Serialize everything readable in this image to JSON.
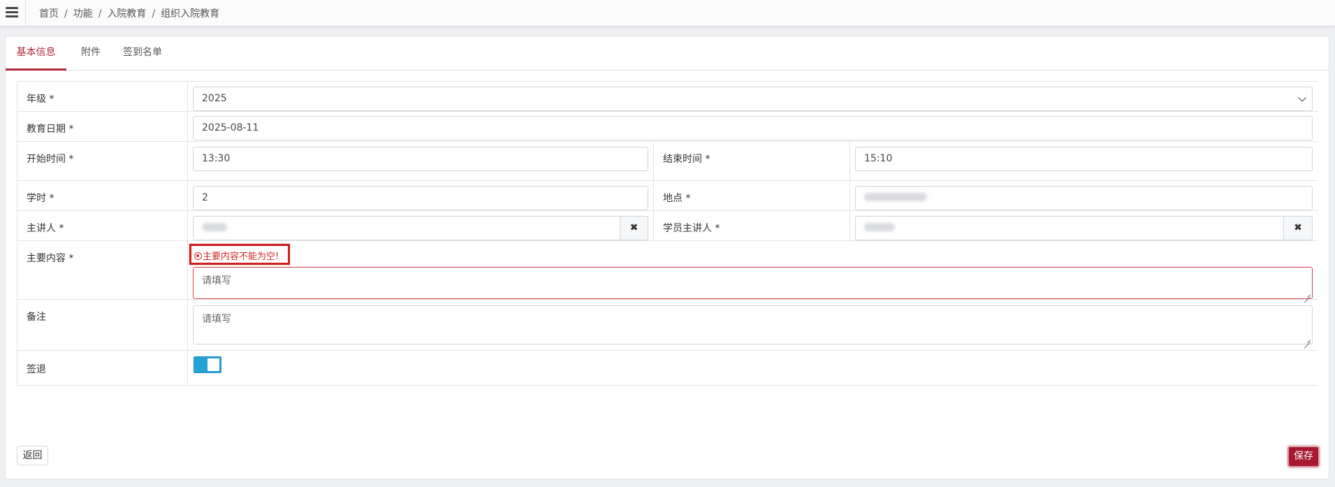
{
  "breadcrumb": {
    "items": [
      "首页",
      "功能",
      "入院教育"
    ],
    "current": "组织入院教育",
    "separator": "/"
  },
  "tabs": [
    {
      "label": "基本信息",
      "active": true
    },
    {
      "label": "附件",
      "active": false
    },
    {
      "label": "签到名单",
      "active": false
    }
  ],
  "form": {
    "grade": {
      "label": "年级 *",
      "value": "2025"
    },
    "edu_date": {
      "label": "教育日期 *",
      "value": "2025-08-11"
    },
    "start_time": {
      "label": "开始时间 *",
      "value": "13:30"
    },
    "end_time": {
      "label": "结束时间 *",
      "value": "15:10"
    },
    "hours": {
      "label": "学时 *",
      "value": "2"
    },
    "location": {
      "label": "地点 *"
    },
    "speaker": {
      "label": "主讲人 *",
      "clear_icon": "✖"
    },
    "student_speaker": {
      "label": "学员主讲人 *",
      "clear_icon": "✖"
    },
    "main_content": {
      "label": "主要内容 *",
      "error": "主要内容不能为空!",
      "placeholder": "请填写"
    },
    "remark": {
      "label": "备注",
      "placeholder": "请填写"
    },
    "sign_out": {
      "label": "签退",
      "enabled": true
    }
  },
  "buttons": {
    "back": "返回",
    "save": "保存"
  },
  "colors": {
    "accent": "#b0283a",
    "save_bg": "#a8182e",
    "error": "#d02b2b",
    "switch_on": "#26a1d6"
  }
}
